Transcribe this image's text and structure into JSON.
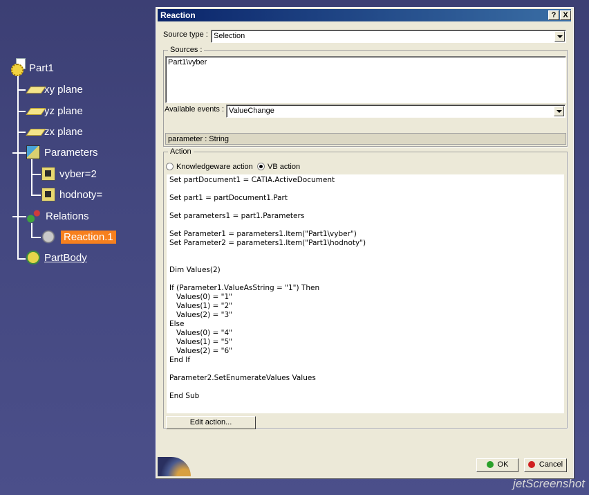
{
  "tree": {
    "root": "Part1",
    "planes": [
      "xy plane",
      "yz plane",
      "zx plane"
    ],
    "parameters": {
      "label": "Parameters",
      "items": [
        "vyber=2",
        "hodnoty="
      ]
    },
    "relations": {
      "label": "Relations",
      "items": [
        "Reaction.1"
      ]
    },
    "body": "PartBody"
  },
  "dialog": {
    "title": "Reaction",
    "help_btn": "?",
    "close_btn": "X",
    "source_type_label": "Source type :",
    "source_type_value": "Selection",
    "sources_label": "Sources :",
    "sources_value": "Part1\\vyber",
    "available_events_label": "Available events :",
    "available_events_value": "ValueChange",
    "parameter_info": "parameter : String",
    "action_label": "Action",
    "radio_knowledgeware": "Knowledgeware action",
    "radio_vb": "VB action",
    "selected_action": "VB action",
    "code": "Set partDocument1 = CATIA.ActiveDocument\n\nSet part1 = partDocument1.Part\n\nSet parameters1 = part1.Parameters\n\nSet Parameter1 = parameters1.Item(\"Part1\\vyber\")\nSet Parameter2 = parameters1.Item(\"Part1\\hodnoty\")\n\n\nDim Values(2)\n\nIf (Parameter1.ValueAsString = \"1\") Then\n   Values(0) = \"1\"\n   Values(1) = \"2\"\n   Values(2) = \"3\"\nElse\n   Values(0) = \"4\"\n   Values(1) = \"5\"\n   Values(2) = \"6\"\nEnd If\n\nParameter2.SetEnumerateValues Values\n\nEnd Sub",
    "edit_action_btn": "Edit action...",
    "ok_btn": "OK",
    "cancel_btn": "Cancel"
  },
  "watermark": "jetScreenshot",
  "colors": {
    "background": "#43477f",
    "dialog": "#ece9d8",
    "titlebar": "#0a246a",
    "highlight": "#f7801e",
    "ok_dot": "#2aa02a",
    "cancel_dot": "#d02020"
  }
}
